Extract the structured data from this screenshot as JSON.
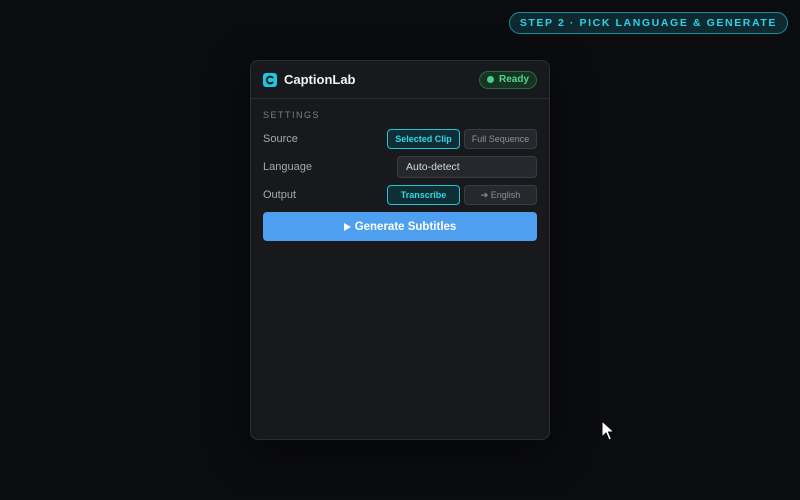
{
  "step_badge": "STEP 2 · PICK LANGUAGE & GENERATE",
  "app": {
    "name": "CaptionLab",
    "status": "Ready"
  },
  "settings": {
    "section_title": "SETTINGS",
    "source": {
      "label": "Source",
      "options": [
        "Selected Clip",
        "Full Sequence"
      ],
      "selected": "Selected Clip"
    },
    "language": {
      "label": "Language",
      "value": "Auto-detect"
    },
    "output": {
      "label": "Output",
      "options": [
        "Transcribe",
        "➔ English"
      ],
      "selected": "Transcribe"
    }
  },
  "generate_button": "Generate Subtitles",
  "colors": {
    "accent_cyan": "#22c2d8",
    "primary_blue": "#4e9ff0",
    "status_green": "#45d27f",
    "panel_bg": "#18191d",
    "page_bg": "#0b0c0f"
  },
  "icons": [
    "caption-logo-icon",
    "status-dot-icon",
    "play-icon",
    "mouse-cursor-icon"
  ]
}
